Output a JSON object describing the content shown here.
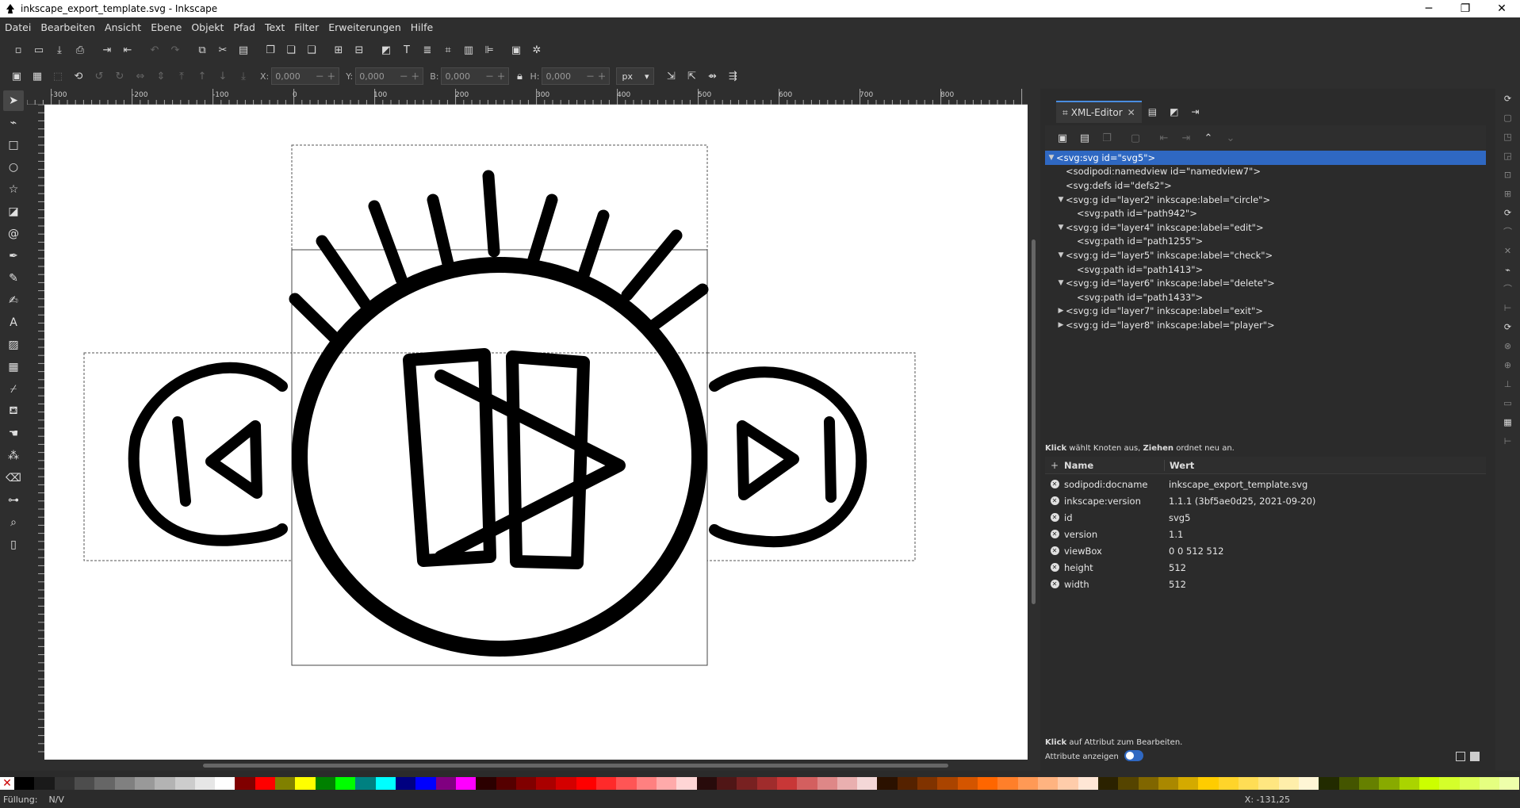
{
  "window": {
    "title": "inkscape_export_template.svg - Inkscape",
    "controls": [
      "─",
      "❐",
      "✕"
    ]
  },
  "menu": [
    "Datei",
    "Bearbeiten",
    "Ansicht",
    "Ebene",
    "Objekt",
    "Pfad",
    "Text",
    "Filter",
    "Erweiterungen",
    "Hilfe"
  ],
  "coords": {
    "x_label": "X:",
    "x_value": "0,000",
    "y_label": "Y:",
    "y_value": "0,000",
    "w_label": "B:",
    "w_value": "0,000",
    "h_label": "H:",
    "h_value": "0,000",
    "unit": "px"
  },
  "ruler": {
    "labels": [
      "-300",
      "-200",
      "-100",
      "0",
      "100",
      "200",
      "300",
      "400",
      "500",
      "600",
      "700",
      "800"
    ]
  },
  "panel": {
    "active_tab": "XML-Editor",
    "tree_nodes": [
      "<svg:svg id=\"svg5\">",
      "<sodipodi:namedview id=\"namedview7\">",
      "<svg:defs id=\"defs2\">",
      "<svg:g id=\"layer2\" inkscape:label=\"circle\">",
      "<svg:path id=\"path942\">",
      "<svg:g id=\"layer4\" inkscape:label=\"edit\">",
      "<svg:path id=\"path1255\">",
      "<svg:g id=\"layer5\" inkscape:label=\"check\">",
      "<svg:path id=\"path1413\">",
      "<svg:g id=\"layer6\" inkscape:label=\"delete\">",
      "<svg:path id=\"path1433\">",
      "<svg:g id=\"layer7\" inkscape:label=\"exit\">",
      "<svg:g id=\"layer8\" inkscape:label=\"player\">"
    ],
    "tree_hint_bold1": "Klick",
    "tree_hint_text1": " wählt Knoten aus, ",
    "tree_hint_bold2": "Ziehen",
    "tree_hint_text2": " ordnet neu an.",
    "attr_header_name": "Name",
    "attr_header_value": "Wert",
    "attributes": [
      {
        "name": "sodipodi:docname",
        "value": "inkscape_export_template.svg"
      },
      {
        "name": "inkscape:version",
        "value": "1.1.1 (3bf5ae0d25, 2021-09-20)"
      },
      {
        "name": "id",
        "value": "svg5"
      },
      {
        "name": "version",
        "value": "1.1"
      },
      {
        "name": "viewBox",
        "value": "0 0 512 512"
      },
      {
        "name": "height",
        "value": "512"
      },
      {
        "name": "width",
        "value": "512"
      }
    ],
    "attr_hint_bold": "Klick",
    "attr_hint_text": " auf Attribut zum Bearbeiten.",
    "show_attributes_label": "Attribute anzeigen"
  },
  "status": {
    "fill_label": "Füllung:",
    "fill_value": "N/V",
    "cursor": "X: -131,25"
  }
}
